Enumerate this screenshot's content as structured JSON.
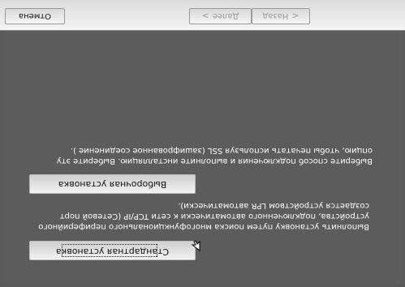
{
  "options": {
    "standard": {
      "label": "Стандартная установка",
      "description": "Выполнить установку путем поиска многофункционального периферийного устройства, подключенного автоматически к сети TCP/IP (Сетевой порт создается устройством LPR автоматически)."
    },
    "selective": {
      "label": "Выборочная установка",
      "description": "Выберите способ подключения и выполните инсталляцию. Выберите эту опцию, чтобы печатать используя SSL (зашифрованное соединение )."
    }
  },
  "footer": {
    "back_label": "Назад",
    "next_label": "Далее",
    "cancel_label": "Отмена",
    "back_icon": "chevron-left-icon",
    "next_icon": "chevron-right-icon"
  },
  "colors": {
    "panel_bg": "#5a5a5a",
    "button_bg": "#e6e6e6",
    "footer_bg": "#e8e8e8",
    "text_light": "#ffffff",
    "text_disabled": "#9a9a9a"
  }
}
